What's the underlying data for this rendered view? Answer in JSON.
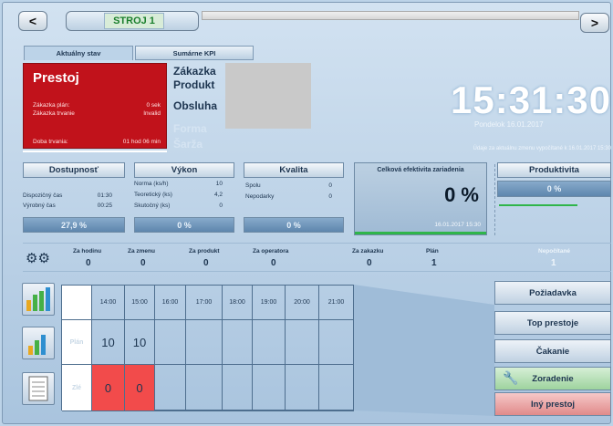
{
  "topbar": {
    "back": "<",
    "forward": ">",
    "machine": "STROJ 1"
  },
  "tabs": [
    {
      "label": "Aktuálny stav"
    },
    {
      "label": "Sumárne KPI"
    }
  ],
  "status": {
    "title": "Prestoj",
    "order_plan_label": "Zákazka plán:",
    "order_plan_value": "0 sek",
    "order_dur_label": "Zákazka trvanie",
    "order_dur_value": "Invalid",
    "duration_label": "Doba trvania:",
    "duration_value": "01 hod 06 min"
  },
  "order_fields": {
    "zakazka": "Zákazka",
    "produkt": "Produkt",
    "obsluha": "Obsluha",
    "forma": "Forma",
    "sarza": "Šarža"
  },
  "clock": {
    "time": "15:31:30",
    "date": "Pondelok 16.01.2017",
    "updated": "Údaje za aktuálnu zmenu vypočítané k 16.01.2017 15:30"
  },
  "kpi": {
    "dostupnost": {
      "label": "Dostupnosť",
      "rows": [
        {
          "label": "Dispozičný čas",
          "value": "01:30"
        },
        {
          "label": "Výrobný čas",
          "value": "00:25"
        }
      ],
      "percent": "27,9 %"
    },
    "vykon": {
      "label": "Výkon",
      "rows": [
        {
          "label": "Norma (ks/h)",
          "value": "10"
        },
        {
          "label": "Teoretický (ks)",
          "value": "4,2"
        },
        {
          "label": "Skutočný (ks)",
          "value": "0"
        }
      ],
      "percent": "0 %"
    },
    "kvalita": {
      "label": "Kvalita",
      "rows": [
        {
          "label": "Spolu",
          "value": "0"
        },
        {
          "label": "Nepodarky",
          "value": "0"
        }
      ],
      "percent": "0 %"
    },
    "oee": {
      "label": "Celková efektivita zariadenia",
      "value": "0 %",
      "timestamp": "16.01.2017 15:30"
    },
    "produktivita": {
      "label": "Produktivita",
      "percent": "0 %"
    }
  },
  "counters": [
    {
      "label": "Za hodinu",
      "value": "0"
    },
    {
      "label": "Za zmenu",
      "value": "0"
    },
    {
      "label": "Za produkt",
      "value": "0"
    },
    {
      "label": "Za operatora",
      "value": "0"
    },
    {
      "label": "Za zakazku",
      "value": "0"
    },
    {
      "label": "Plán",
      "value": "1"
    },
    {
      "label": "Nepočítané",
      "value": "1"
    }
  ],
  "grid": {
    "hours": [
      "14:00",
      "15:00",
      "16:00",
      "17:00",
      "18:00",
      "19:00",
      "20:00",
      "21:00"
    ],
    "row_labels": [
      "Plán",
      "Zlé"
    ],
    "plan": [
      "10",
      "10",
      "",
      "",
      "",
      "",
      "",
      ""
    ],
    "bad": [
      "0",
      "0",
      "",
      "",
      "",
      "",
      "",
      ""
    ]
  },
  "actions": [
    {
      "label": "Požiadavka"
    },
    {
      "label": "Top prestoje"
    },
    {
      "label": "Čakanie"
    },
    {
      "label": "Zoradenie"
    },
    {
      "label": "Iný prestoj"
    }
  ],
  "colors": {
    "alarm_red": "#c1121b",
    "cell_red": "#f24b4b",
    "green_accent": "#2fb54a"
  }
}
